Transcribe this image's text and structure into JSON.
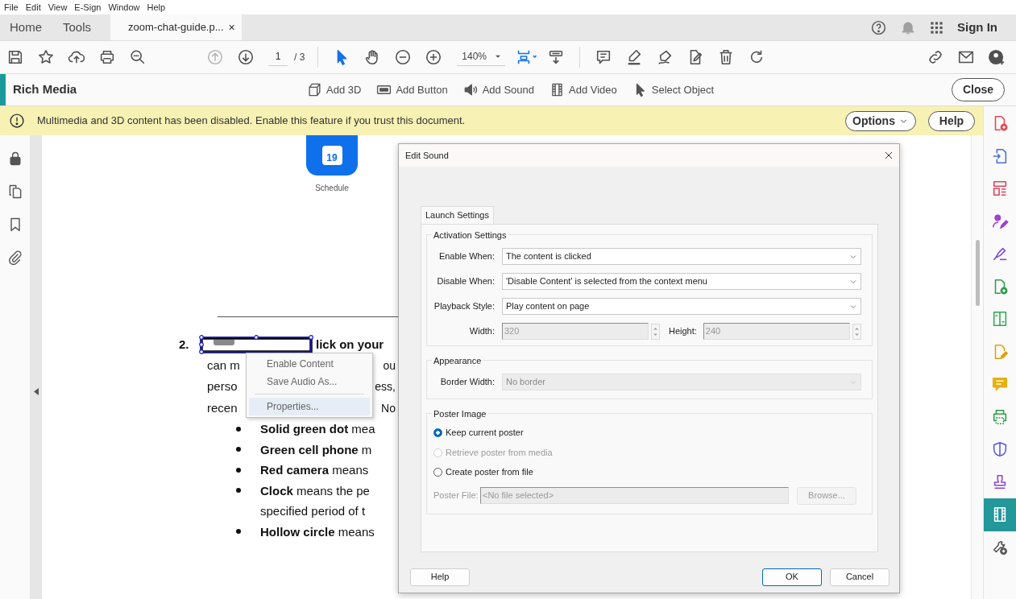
{
  "menu_bar": [
    "File",
    "Edit",
    "View",
    "E-Sign",
    "Window",
    "Help"
  ],
  "tab_bar": {
    "tabs": [
      {
        "kind": "nav",
        "label": "Home",
        "selected": false
      },
      {
        "kind": "nav",
        "label": "Tools",
        "selected": false
      },
      {
        "kind": "document",
        "label": "zoom-chat-guide.p...",
        "selected": true,
        "close": "×"
      }
    ],
    "sign_in": "Sign In"
  },
  "toolbar": {
    "file_tools": [
      {
        "kind": "save",
        "disabled": false,
        "active": false
      },
      {
        "kind": "star",
        "disabled": false,
        "active": false
      },
      {
        "kind": "upload",
        "disabled": false,
        "active": false
      },
      {
        "kind": "print",
        "disabled": false,
        "active": false
      },
      {
        "kind": "search",
        "disabled": false,
        "active": false
      }
    ],
    "nav_tools": [
      {
        "kind": "up",
        "disabled": true,
        "active": false
      },
      {
        "kind": "down",
        "disabled": false,
        "active": false
      }
    ],
    "page": {
      "current": "1",
      "total": "/ 3"
    },
    "view_tools": [
      {
        "kind": "pointer",
        "disabled": false,
        "active": true
      },
      {
        "kind": "hand",
        "disabled": false,
        "active": false
      },
      {
        "kind": "zoom_out",
        "disabled": false,
        "active": false
      },
      {
        "kind": "zoom_in",
        "disabled": false,
        "active": false
      }
    ],
    "zoom": "140%",
    "layout_tools": [
      {
        "kind": "fit",
        "disabled": false,
        "active": true
      },
      {
        "kind": "scroll",
        "disabled": false,
        "active": false
      }
    ],
    "edit_tools": [
      {
        "kind": "comment",
        "disabled": false,
        "active": false
      },
      {
        "kind": "highlight",
        "disabled": false,
        "active": false
      },
      {
        "kind": "sign",
        "disabled": false,
        "active": false
      },
      {
        "kind": "edit",
        "disabled": false,
        "active": false
      },
      {
        "kind": "trash",
        "disabled": false,
        "active": false
      },
      {
        "kind": "rotate",
        "disabled": false,
        "active": false
      }
    ],
    "share_tools": [
      {
        "kind": "link",
        "disabled": false,
        "active": false
      },
      {
        "kind": "mail",
        "disabled": false,
        "active": false
      },
      {
        "kind": "user",
        "disabled": false,
        "active": false
      }
    ]
  },
  "rich_media_bar": {
    "title": "Rich Media",
    "actions": [
      {
        "kind": "model",
        "label": "Add 3D"
      },
      {
        "kind": "button",
        "label": "Add Button"
      },
      {
        "kind": "sound",
        "label": "Add Sound"
      },
      {
        "kind": "video",
        "label": "Add Video"
      },
      {
        "kind": "select",
        "label": "Select Object"
      }
    ],
    "close": "Close"
  },
  "banner": {
    "message": "Multimedia and 3D content has been disabled. Enable this feature if you trust this document.",
    "options": "Options",
    "help": "Help"
  },
  "left_rail": [
    {
      "kind": "lock"
    },
    {
      "kind": "pages"
    },
    {
      "kind": "bookmark"
    },
    {
      "kind": "attach"
    }
  ],
  "right_rail": [
    {
      "kind": "doc_plus",
      "color": "#e34850",
      "selected": false
    },
    {
      "kind": "doc_arrow",
      "color": "#4a6ee0",
      "selected": false
    },
    {
      "kind": "layout",
      "color": "#e2405a",
      "selected": false
    },
    {
      "kind": "person_pen",
      "color": "#a23fd6",
      "selected": false
    },
    {
      "kind": "pen",
      "color": "#7a4ad8",
      "selected": false
    },
    {
      "kind": "doc_plus",
      "color": "#2d9d4a",
      "selected": false
    },
    {
      "kind": "split",
      "color": "#2fa84f",
      "selected": false
    },
    {
      "kind": "doc_pen",
      "color": "#e0a10a",
      "selected": false
    },
    {
      "kind": "bubble",
      "color": "#e8b00c",
      "selected": false
    },
    {
      "kind": "print",
      "color": "#2aa046",
      "selected": false
    },
    {
      "kind": "shield",
      "color": "#5b57e0",
      "selected": false
    },
    {
      "kind": "stamp",
      "color": "#8b45d6",
      "selected": false
    },
    {
      "kind": "film",
      "color": "#23979a",
      "selected": true
    },
    {
      "kind": "wrench_plus",
      "color": "#555555",
      "selected": false
    }
  ],
  "document": {
    "app_icon": {
      "date": "19",
      "label": "Schedule"
    },
    "step_number": "2.",
    "media_object": {
      "selected": true
    },
    "step_text": "lick on your",
    "step_lines": [
      {
        "left": "can m",
        "right": "ou"
      },
      {
        "left": "perso",
        "right": "ess,"
      },
      {
        "left": "recen",
        "right": "No"
      }
    ],
    "bullets": [
      {
        "lines": [
          "**Solid green dot** mea"
        ]
      },
      {
        "lines": [
          "**Green cell phone** m"
        ]
      },
      {
        "lines": [
          "**Red camera** means"
        ]
      },
      {
        "lines": [
          "**Clock** means the pe",
          "specified period of t"
        ]
      },
      {
        "lines": [
          "**Hollow circle** means"
        ]
      }
    ]
  },
  "context_menu": {
    "sections": [
      {
        "items": [
          {
            "label": "Enable Content",
            "selected": false
          },
          {
            "label": "Save Audio As...",
            "selected": false
          }
        ]
      },
      {
        "items": [
          {
            "label": "Properties...",
            "selected": true
          }
        ]
      }
    ]
  },
  "dialog": {
    "title": "Edit Sound",
    "tabs": [
      {
        "label": "Launch Settings",
        "selected": true
      }
    ],
    "groups": [
      {
        "legend": "Activation Settings",
        "rows": [
          {
            "kind": "select",
            "label": "Enable When:",
            "value": "The content is clicked",
            "disabled": false
          },
          {
            "kind": "select",
            "label": "Disable When:",
            "value": "'Disable Content' is selected from the context menu",
            "disabled": false
          },
          {
            "kind": "select",
            "label": "Playback Style:",
            "value": "Play content on page",
            "disabled": false
          },
          {
            "kind": "spinners",
            "fields": [
              {
                "label": "Width:",
                "value": "320",
                "disabled": true
              },
              {
                "label": "Height:",
                "value": "240",
                "disabled": true
              }
            ]
          }
        ]
      },
      {
        "legend": "Appearance",
        "rows": [
          {
            "kind": "select",
            "label": "Border Width:",
            "value": "No border",
            "disabled": true
          }
        ]
      },
      {
        "legend": "Poster Image",
        "rows": [
          {
            "kind": "radio",
            "label": "Keep current poster",
            "selected": true,
            "disabled": false
          },
          {
            "kind": "radio",
            "label": "Retrieve poster from media",
            "selected": false,
            "disabled": true
          },
          {
            "kind": "radio",
            "label": "Create poster from file",
            "selected": false,
            "disabled": false
          },
          {
            "kind": "file",
            "label": "Poster File:",
            "value": "<No file selected>",
            "button": "Browse...",
            "disabled": true
          }
        ]
      }
    ],
    "buttons_left": [
      {
        "label": "Help",
        "default": false
      }
    ],
    "buttons_right": [
      {
        "label": "OK",
        "default": true
      },
      {
        "label": "Cancel",
        "default": false
      }
    ]
  }
}
